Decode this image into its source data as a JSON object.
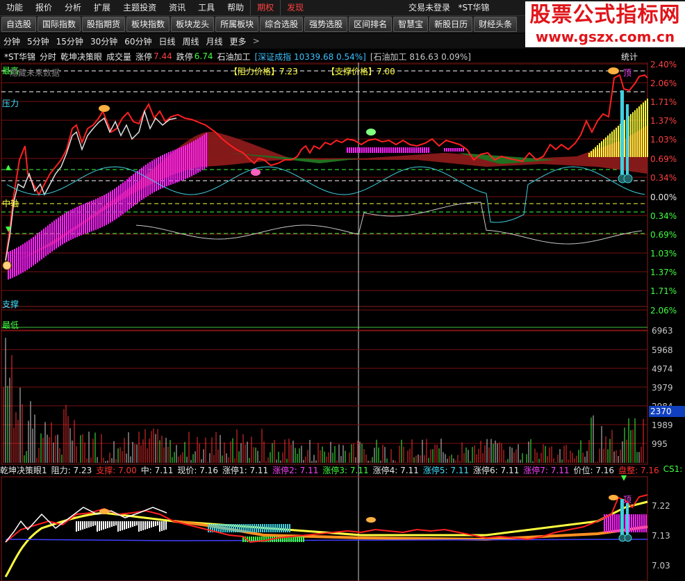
{
  "menubar": {
    "items": [
      "功能",
      "报价",
      "分析",
      "扩展",
      "主题投资",
      "资讯",
      "工具",
      "帮助"
    ],
    "red_items": [
      "期权",
      "发现"
    ],
    "status": "交易未登录",
    "stock": "*ST华锦"
  },
  "toolbar": {
    "buttons": [
      "自选股",
      "国际指数",
      "股指期货",
      "板块指数",
      "板块龙头",
      "所属板块",
      "综合选股",
      "强势选股",
      "区间排名",
      "智慧宝",
      "新股日历",
      "财经头条"
    ]
  },
  "periods": {
    "items": [
      "分钟",
      "5分钟",
      "15分钟",
      "30分钟",
      "60分钟",
      "日线",
      "周线",
      "月线",
      "更多"
    ],
    "arrow": ">",
    "right_tabs": [
      "竞价",
      "叠加",
      "画线",
      "F10",
      "标记",
      "+自选"
    ]
  },
  "watermark": {
    "title": "股票公式指标网",
    "url": "www.gszx.com.cn"
  },
  "infobar": {
    "name": "*ST华锦",
    "mode": "分时",
    "indicator": "乾坤决策眼",
    "volume": "成交量",
    "up_limit_label": "涨停",
    "up_limit": "7.44",
    "down_limit_label": "跌停",
    "down_limit": "6.74",
    "sector": "石油加工",
    "index1": "[深证成指 10339.68 0.54%]",
    "index2": "[石油加工 816.63 0.09%]",
    "stats": "统计"
  },
  "main_chart": {
    "future_data": "隐藏未来数据",
    "resistance_label": "【阻力价格】",
    "resistance_value": "7.23",
    "support_label": "【支撑价格】",
    "support_value": "7.00",
    "levels": {
      "high": "最高",
      "pressure": "压力",
      "middle": "中轴",
      "support": "支撑",
      "low": "最低"
    },
    "top_label": "顶",
    "pct_ticks": [
      "2.40%",
      "2.06%",
      "1.71%",
      "1.37%",
      "1.03%",
      "0.69%",
      "0.34%",
      "0.00%",
      "0.34%",
      "0.69%",
      "1.03%",
      "1.37%",
      "1.71%",
      "2.06%"
    ],
    "small_labels": [
      "68",
      "69",
      "67",
      "9",
      "78",
      "6",
      "9",
      "7",
      "78",
      "6",
      "7",
      "9",
      "578"
    ]
  },
  "volume_chart": {
    "ticks": [
      "6963",
      "5968",
      "4974",
      "3979",
      "2984",
      "1989",
      "995"
    ],
    "highlight": "2370"
  },
  "indicator_legend": {
    "items": [
      {
        "text": "乾坤决策眼1",
        "color": "#e8e8e8"
      },
      {
        "text": "阻力: 7.23",
        "color": "#e8e8e8"
      },
      {
        "text": "支撑: 7.00",
        "color": "#ff3030"
      },
      {
        "text": "中: 7.11",
        "color": "#e8e8e8"
      },
      {
        "text": "现价: 7.16",
        "color": "#e8e8e8"
      },
      {
        "text": "涨停1: 7.11",
        "color": "#e8e8e8"
      },
      {
        "text": "涨停2: 7.11",
        "color": "#ff40ff"
      },
      {
        "text": "涨停3: 7.11",
        "color": "#40ff40"
      },
      {
        "text": "涨停4: 7.11",
        "color": "#e8e8e8"
      },
      {
        "text": "涨停5: 7.11",
        "color": "#40e0ff"
      },
      {
        "text": "涨停6: 7.11",
        "color": "#e8e8e8"
      },
      {
        "text": "涨停7: 7.11",
        "color": "#ff40ff"
      },
      {
        "text": "价位: 7.16",
        "color": "#e8e8e8"
      },
      {
        "text": "盘整: 7.16",
        "color": "#ff3030"
      },
      {
        "text": "CS1: -",
        "color": "#40ff40"
      },
      {
        "text": "GS",
        "color": "#ffff40"
      }
    ],
    "ticks": [
      "7.22",
      "7.13",
      "7.03"
    ],
    "top_label": "顶"
  },
  "colors": {
    "price_line": "#ff2020",
    "avg_line": "#ffffff",
    "magenta": "#ff20ff",
    "dark_red": "#8b1a1a",
    "cyan": "#40d0e0",
    "yellow": "#ffff40",
    "green": "#20c020"
  }
}
